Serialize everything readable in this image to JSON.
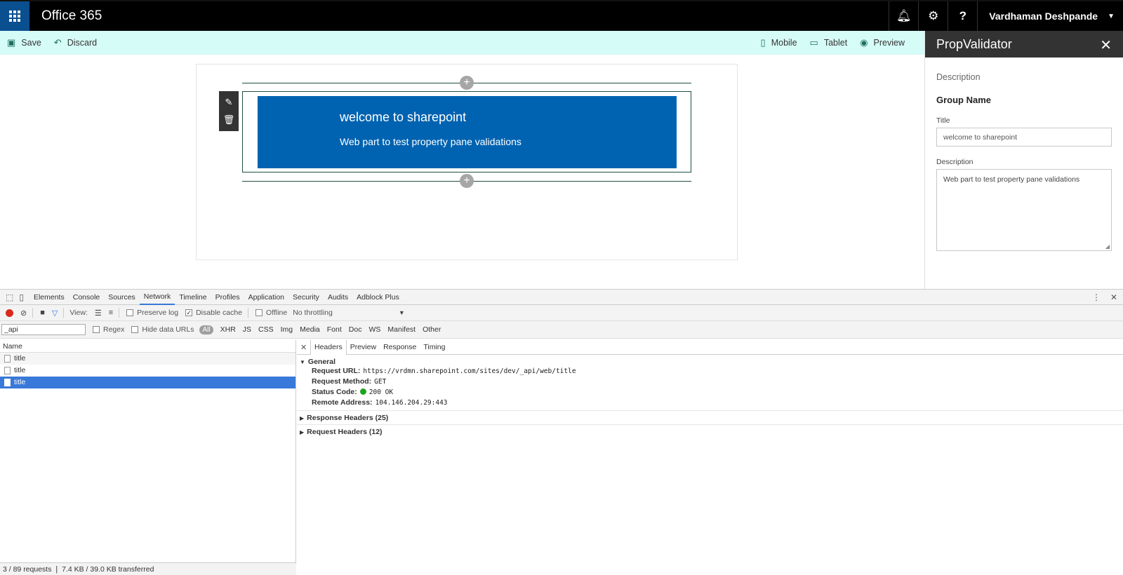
{
  "topbar": {
    "title": "Office 365",
    "user": "Vardhaman Deshpande"
  },
  "cmdbar": {
    "save": "Save",
    "discard": "Discard",
    "mobile": "Mobile",
    "tablet": "Tablet",
    "preview": "Preview"
  },
  "webpart": {
    "title": "welcome to sharepoint",
    "description": "Web part to test property pane validations"
  },
  "pane": {
    "title": "PropValidator",
    "subtitle": "Description",
    "group": "Group Name",
    "title_label": "Title",
    "title_value": "welcome to sharepoint",
    "desc_label": "Description",
    "desc_value": "Web part to test property pane validations"
  },
  "devtools": {
    "tabs": [
      "Elements",
      "Console",
      "Sources",
      "Network",
      "Timeline",
      "Profiles",
      "Application",
      "Security",
      "Audits",
      "Adblock Plus"
    ],
    "controls": {
      "view": "View:",
      "preserve_log": "Preserve log",
      "disable_cache": "Disable cache",
      "offline": "Offline",
      "throttling": "No throttling"
    },
    "filter": {
      "value": "_api",
      "regex": "Regex",
      "hide_data": "Hide data URLs",
      "all": "All",
      "types": [
        "XHR",
        "JS",
        "CSS",
        "Img",
        "Media",
        "Font",
        "Doc",
        "WS",
        "Manifest",
        "Other"
      ]
    },
    "list": {
      "header": "Name",
      "rows": [
        "title",
        "title",
        "title"
      ],
      "status": "3 / 89 requests  ❘  7.4 KB / 39.0 KB transferred"
    },
    "detail": {
      "tabs": [
        "Headers",
        "Preview",
        "Response",
        "Timing"
      ],
      "general": "General",
      "request_url_k": "Request URL:",
      "request_url_v": "https://vrdmn.sharepoint.com/sites/dev/_api/web/title",
      "method_k": "Request Method:",
      "method_v": "GET",
      "status_k": "Status Code:",
      "status_v": "200 OK",
      "remote_k": "Remote Address:",
      "remote_v": "104.146.204.29:443",
      "response_headers": "Response Headers (25)",
      "request_headers": "Request Headers (12)"
    }
  }
}
